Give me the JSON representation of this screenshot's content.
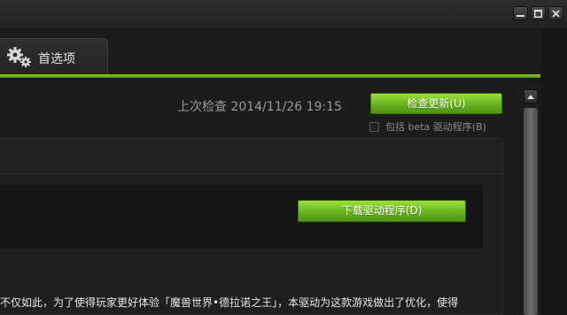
{
  "window": {
    "controls": [
      {
        "name": "minimize",
        "icon": "minimize-icon"
      },
      {
        "name": "maximize",
        "icon": "maximize-icon"
      },
      {
        "name": "close",
        "icon": "close-icon"
      }
    ]
  },
  "tabs": [
    {
      "label": "首选项",
      "icon": "gears-icon",
      "active": true
    }
  ],
  "updates": {
    "last_check": "上次检查 2014/11/26 19:15",
    "check_button": "检查更新(U)",
    "include_beta_label": "包括 beta 驱动程序(B)",
    "include_beta_checked": false
  },
  "driver": {
    "download_button": "下载驱动程序(D)",
    "description": "不仅如此，为了使得玩家更好体验「魔兽世界•德拉诺之王」，本驱动为这款游戏做出了优化，使得"
  },
  "colors": {
    "accent_green": "#76c020",
    "background": "#1a1a1a"
  }
}
